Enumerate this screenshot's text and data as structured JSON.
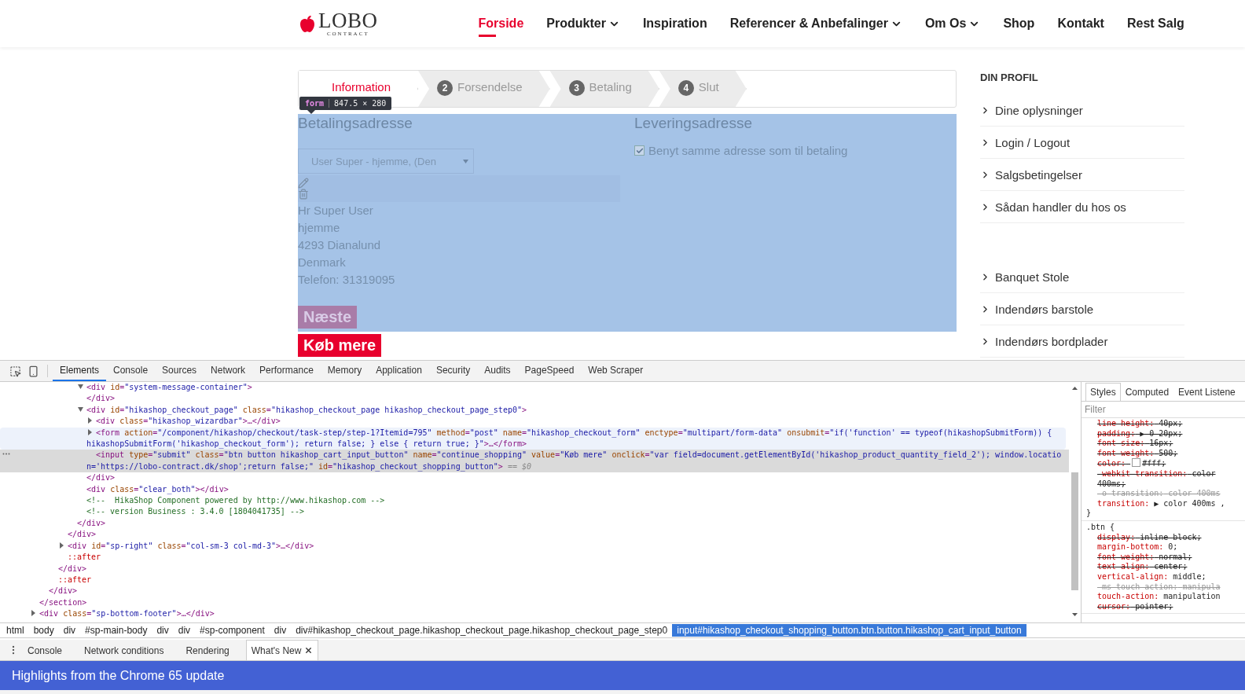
{
  "site": {
    "logo": {
      "name": "LOBO",
      "tagline": "CONTRACT"
    },
    "nav": [
      {
        "label": "Forside",
        "selected": true,
        "dropdown": false
      },
      {
        "label": "Produkter",
        "selected": false,
        "dropdown": true
      },
      {
        "label": "Inspiration",
        "selected": false,
        "dropdown": false
      },
      {
        "label": "Referencer & Anbefalinger",
        "selected": false,
        "dropdown": true
      },
      {
        "label": "Om Os",
        "selected": false,
        "dropdown": true
      },
      {
        "label": "Shop",
        "selected": false,
        "dropdown": false
      },
      {
        "label": "Kontakt",
        "selected": false,
        "dropdown": false
      },
      {
        "label": "Rest Salg",
        "selected": false,
        "dropdown": false
      }
    ],
    "steps": [
      {
        "label": "Information",
        "selected": true
      },
      {
        "number": "2",
        "label": "Forsendelse",
        "selected": false
      },
      {
        "number": "3",
        "label": "Betaling",
        "selected": false
      },
      {
        "number": "4",
        "label": "Slut",
        "selected": false
      }
    ],
    "inspector_tooltip": {
      "tag": "form",
      "size": "847.5 × 280"
    },
    "billing": {
      "heading": "Betalingsadresse",
      "address_select": "User Super - hjemme, (Den",
      "address_lines": [
        "Hr Super User",
        "hjemme",
        "4293 Dianalund",
        "Denmark",
        "Telefon: 31319095"
      ]
    },
    "shipping": {
      "heading": "Leveringsadresse",
      "same_as_billing": {
        "label": "Benyt samme adresse som til betaling",
        "checked": true
      }
    },
    "buttons": [
      {
        "label": "Næste",
        "kind": "next"
      },
      {
        "label": "Køb mere",
        "kind": "continue"
      }
    ],
    "sidebar": {
      "heading": "DIN PROFIL",
      "menus": [
        [
          "Dine oplysninger",
          "Login / Logout",
          "Salgsbetingelser",
          "Sådan handler du hos os"
        ],
        [
          "Banquet Stole",
          "Indendørs barstole",
          "Indendørs bordplader"
        ]
      ]
    }
  },
  "devtools": {
    "tabs": [
      {
        "label": "Elements",
        "selected": true
      },
      {
        "label": "Console",
        "selected": false
      },
      {
        "label": "Sources",
        "selected": false
      },
      {
        "label": "Network",
        "selected": false
      },
      {
        "label": "Performance",
        "selected": false
      },
      {
        "label": "Memory",
        "selected": false
      },
      {
        "label": "Application",
        "selected": false
      },
      {
        "label": "Security",
        "selected": false
      },
      {
        "label": "Audits",
        "selected": false
      },
      {
        "label": "PageSpeed",
        "selected": false
      },
      {
        "label": "Web Scraper",
        "selected": false
      }
    ],
    "dom_tree": [
      {
        "children": [
          {
            "children": [
              {
                "children": [
                  {
                    "children": [
                      {
                        "children": [
                          {
                            "open": "<div id=\"system-message-container\">",
                            "expanded": true,
                            "close": "</div>"
                          },
                          {
                            "open": "<div id=\"hikashop_checkout_page\" class=\"hikashop_checkout_page hikashop_checkout_page_step0\">",
                            "expanded": true,
                            "children": [
                              {
                                "open": "<div class=\"hikashop_wizardbar\">…</div>",
                                "expanded": false
                              },
                              {
                                "open": "<form action=\"/component/hikashop/checkout/task-step/step-1?Itemid=795\" method=\"post\" name=\"hikashop_checkout_form\" enctype=\"multipart/form-data\" onsubmit=\"if('function' == typeof(hikashopSubmitForm)) { hikashopSubmitForm('hikashop_checkout_form'); return false; } else { return true; }\">…</form>",
                                "expanded": false,
                                "hovered": true,
                                "selected": false
                              },
                              {
                                "open": "<input type=\"submit\" class=\"btn button hikashop_cart_input_button\" name=\"continue_shopping\" value=\"Køb mere\" onclick=\"var field=document.getElementById('hikashop_product_quantity_field_2'); window.location='https://lobo-contract.dk/shop';return false;\" id=\"hikashop_checkout_shopping_button\"> == $0",
                                "hovered": false,
                                "selected": true
                              }
                            ],
                            "close": "</div>"
                          },
                          {
                            "open": "<div class=\"clear_both\"></div>"
                          },
                          {
                            "open": "<!--  HikaShop Component powered by http://www.hikashop.com -->"
                          },
                          {
                            "open": "<!-- version Business : 3.4.0 [1804041735] -->"
                          }
                        ],
                        "close": "</div>"
                      }
                    ],
                    "close": "</div>"
                  },
                  {
                    "open": "<div id=\"sp-right\" class=\"col-sm-3 col-md-3\">…</div>",
                    "expanded": false
                  },
                  {
                    "open": "::after"
                  }
                ],
                "close": "</div>"
              },
              {
                "open": "::after"
              }
            ],
            "close": "</div>"
          }
        ],
        "close": "</section>"
      },
      {
        "open": "<div class=\"sp-bottom-footer\">…</div>",
        "expanded": false
      }
    ],
    "styles_panel": {
      "tabs": [
        {
          "label": "Styles",
          "selected": true
        },
        {
          "label": "Computed",
          "selected": false
        },
        {
          "label": "Event Listene",
          "selected": false
        }
      ],
      "filter": {
        "placeholder": "Filter"
      },
      "rules": [
        {
          "properties": [
            {
              "name": "line-height:",
              "value": "40px;",
              "overridden": true,
              "invalid": false
            },
            {
              "name": "padding:",
              "value": "▶ 0 20px;",
              "overridden": true,
              "invalid": false
            },
            {
              "name": "font-size:",
              "value": "16px;",
              "overridden": true,
              "invalid": false
            },
            {
              "name": "font-weight:",
              "value": "500;",
              "overridden": true,
              "invalid": false
            },
            {
              "name": "color:",
              "value": "#fff;",
              "overridden": true,
              "invalid": false,
              "color": "#ffffff"
            },
            {
              "name": "-webkit-transition:",
              "value": "color 400ms;",
              "overridden": true,
              "invalid": false
            },
            {
              "name": "-o-transition:",
              "value": "color 400ms",
              "overridden": true,
              "invalid": true
            },
            {
              "name": "transition:",
              "value": "▶ color 400ms ,",
              "overridden": false,
              "invalid": false
            }
          ],
          "close": "}"
        },
        {
          "selector": ".btn {",
          "properties": [
            {
              "name": "display:",
              "value": "inline-block;",
              "overridden": true,
              "invalid": false
            },
            {
              "name": "margin-bottom:",
              "value": "0;",
              "overridden": false,
              "invalid": false
            },
            {
              "name": "font-weight:",
              "value": "normal;",
              "overridden": true,
              "invalid": false
            },
            {
              "name": "text-align:",
              "value": "center;",
              "overridden": true,
              "invalid": false
            },
            {
              "name": "vertical-align:",
              "value": "middle;",
              "overridden": false,
              "invalid": false
            },
            {
              "name": "-ms-touch-action:",
              "value": "manipula",
              "overridden": true,
              "invalid": true
            },
            {
              "name": "touch-action:",
              "value": "manipulation",
              "overridden": false,
              "invalid": false
            },
            {
              "name": "cursor:",
              "value": "pointer;",
              "overridden": true,
              "invalid": false
            }
          ]
        }
      ]
    },
    "breadcrumbs": [
      {
        "label": "html",
        "selected": false
      },
      {
        "label": "body",
        "selected": false
      },
      {
        "label": "div",
        "selected": false
      },
      {
        "label": "#sp-main-body",
        "selected": false
      },
      {
        "label": "div",
        "selected": false
      },
      {
        "label": "div",
        "selected": false
      },
      {
        "label": "#sp-component",
        "selected": false
      },
      {
        "label": "div",
        "selected": false
      },
      {
        "label": "div#hikashop_checkout_page.hikashop_checkout_page.hikashop_checkout_page_step0",
        "selected": false
      },
      {
        "label": "input#hikashop_checkout_shopping_button.btn.button.hikashop_cart_input_button",
        "selected": true
      }
    ],
    "drawer_tabs": [
      {
        "label": "Console",
        "selected": false
      },
      {
        "label": "Network conditions",
        "selected": false
      },
      {
        "label": "Rendering",
        "selected": false
      },
      {
        "label": "What's New",
        "selected": true
      }
    ],
    "banner": "Highlights from the Chrome 65 update"
  }
}
